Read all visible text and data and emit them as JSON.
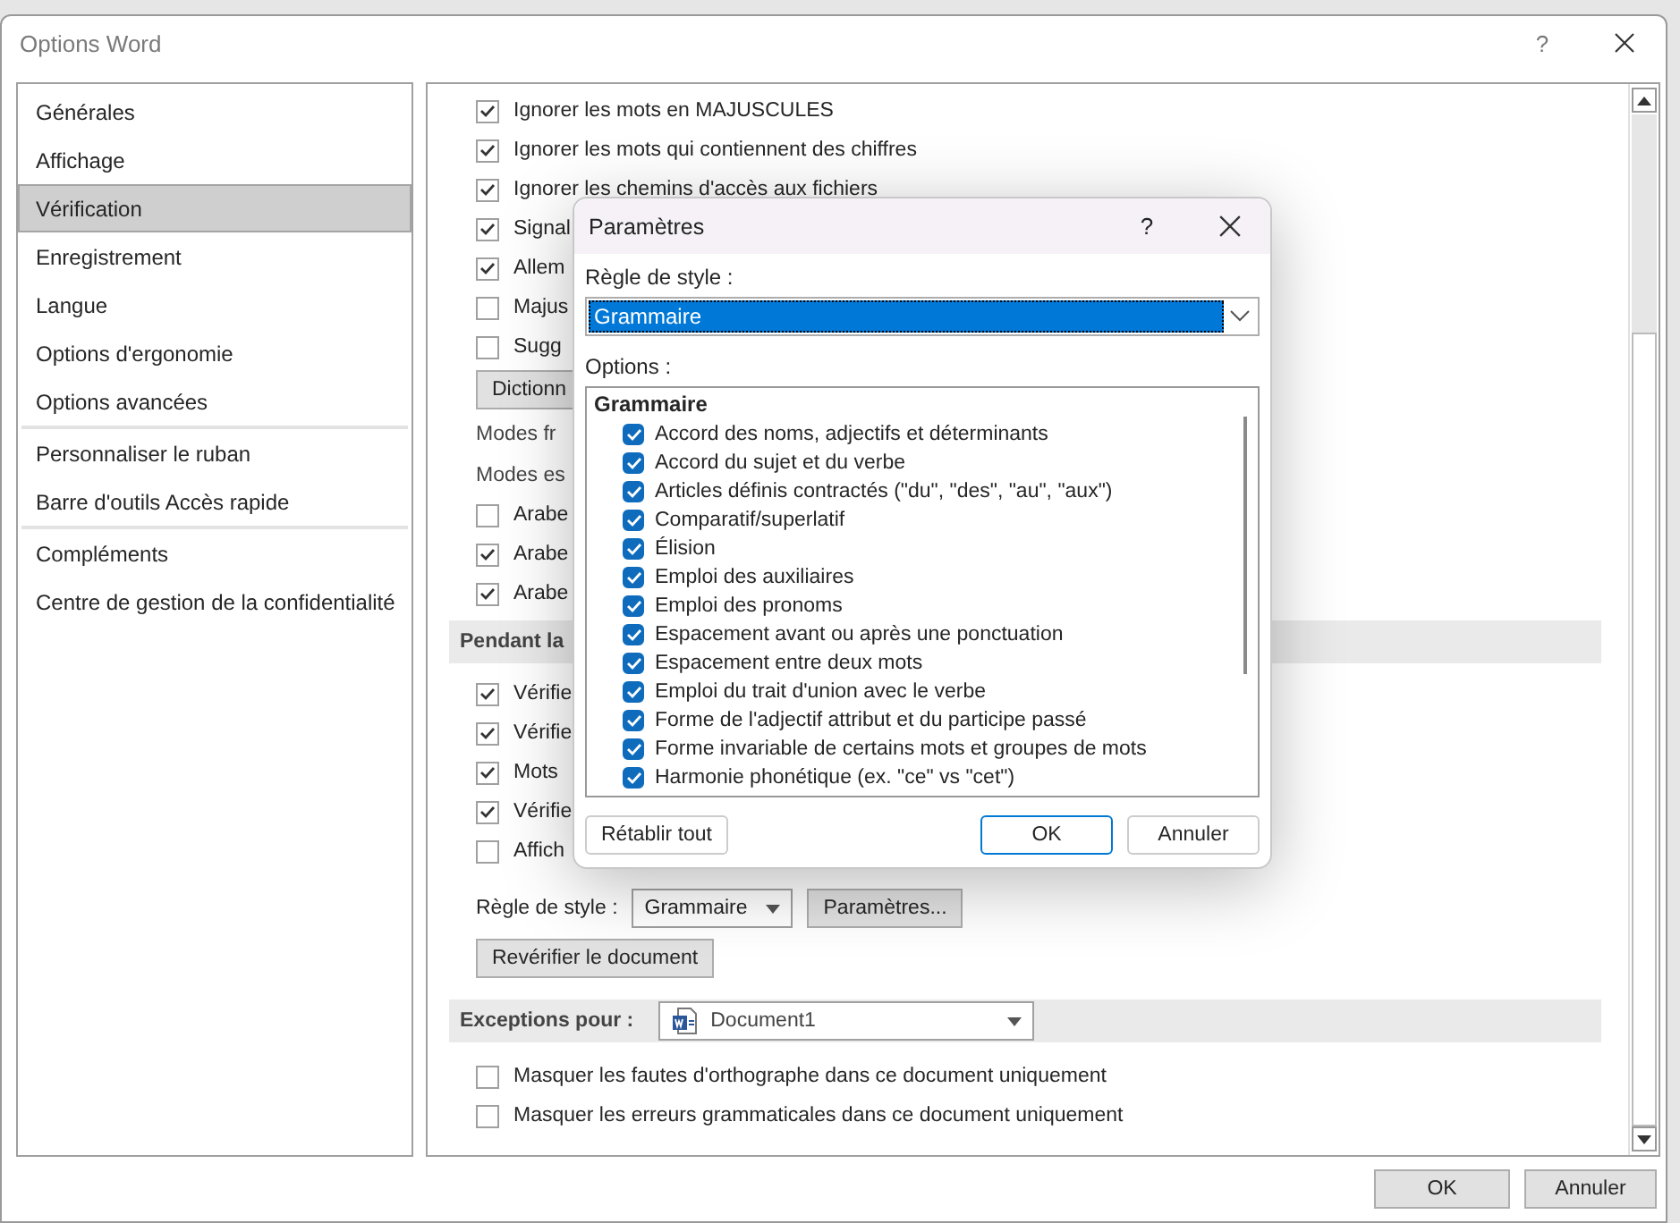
{
  "window": {
    "title": "Options Word",
    "help": "?"
  },
  "sidebar": {
    "groups": [
      {
        "items": [
          {
            "label": "Générales",
            "selected": false
          },
          {
            "label": "Affichage",
            "selected": false
          },
          {
            "label": "Vérification",
            "selected": true
          },
          {
            "label": "Enregistrement",
            "selected": false
          },
          {
            "label": "Langue",
            "selected": false
          },
          {
            "label": "Options d'ergonomie",
            "selected": false
          },
          {
            "label": "Options avancées",
            "selected": false
          }
        ]
      },
      {
        "items": [
          {
            "label": "Personnaliser le ruban",
            "selected": false
          },
          {
            "label": "Barre d'outils Accès rapide",
            "selected": false
          }
        ]
      },
      {
        "items": [
          {
            "label": "Compléments",
            "selected": false
          },
          {
            "label": "Centre de gestion de la confidentialité",
            "selected": false
          }
        ]
      }
    ]
  },
  "content": {
    "rows": [
      {
        "kind": "checkbox",
        "label": "Ignorer les mots en MAJUSCULES",
        "checked": true
      },
      {
        "kind": "checkbox",
        "label": "Ignorer les mots qui contiennent des chiffres",
        "checked": true
      },
      {
        "kind": "checkbox",
        "label": "Ignorer les chemins d'accès aux fichiers",
        "checked": true
      },
      {
        "kind": "checkbox",
        "label": "Signal",
        "checked": true
      },
      {
        "kind": "checkbox",
        "label": "Allem",
        "checked": true
      },
      {
        "kind": "checkbox",
        "label": "Majus",
        "checked": false
      },
      {
        "kind": "checkbox",
        "label": "Sugg",
        "checked": false
      },
      {
        "kind": "button",
        "label": "Dictionn"
      },
      {
        "kind": "text",
        "label": "Modes fr"
      },
      {
        "kind": "text",
        "label": "Modes es"
      },
      {
        "kind": "checkbox",
        "label": "Arabe",
        "checked": false
      },
      {
        "kind": "checkbox",
        "label": "Arabe",
        "checked": true
      },
      {
        "kind": "checkbox",
        "label": "Arabe",
        "checked": true
      },
      {
        "kind": "section",
        "label": "Pendant la"
      },
      {
        "kind": "checkbox",
        "label": "Vérifie",
        "checked": true
      },
      {
        "kind": "checkbox",
        "label": "Vérifie",
        "checked": true
      },
      {
        "kind": "checkbox",
        "label": "Mots",
        "checked": true
      },
      {
        "kind": "checkbox",
        "label": "Vérifie",
        "checked": true
      },
      {
        "kind": "checkbox",
        "label": "Affich",
        "checked": false
      },
      {
        "kind": "style_rule",
        "label": "Règle de style :",
        "value": "Grammaire",
        "button": "Paramètres..."
      },
      {
        "kind": "button",
        "label": "Revérifier le document"
      },
      {
        "kind": "exceptions",
        "label": "Exceptions pour :",
        "value": "Document1"
      },
      {
        "kind": "checkbox",
        "label": "Masquer les fautes d'orthographe dans ce document uniquement",
        "checked": false
      },
      {
        "kind": "checkbox",
        "label": "Masquer les erreurs grammaticales dans ce document uniquement",
        "checked": false
      }
    ]
  },
  "footer": {
    "buttons": [
      "OK",
      "Annuler"
    ]
  },
  "modal": {
    "title": "Paramètres",
    "help": "?",
    "style_label": "Règle de style :",
    "style_value": "Grammaire",
    "options_label": "Options :",
    "group": "Grammaire",
    "options": [
      {
        "label": "Accord des noms, adjectifs et déterminants",
        "checked": true
      },
      {
        "label": "Accord du sujet et du verbe",
        "checked": true
      },
      {
        "label": "Articles définis contractés (\"du\", \"des\", \"au\", \"aux\")",
        "checked": true
      },
      {
        "label": "Comparatif/superlatif",
        "checked": true
      },
      {
        "label": "Élision",
        "checked": true
      },
      {
        "label": "Emploi des auxiliaires",
        "checked": true
      },
      {
        "label": "Emploi des pronoms",
        "checked": true
      },
      {
        "label": "Espacement avant ou après une ponctuation",
        "checked": true
      },
      {
        "label": "Espacement entre deux mots",
        "checked": true
      },
      {
        "label": "Emploi du trait d'union avec le verbe",
        "checked": true
      },
      {
        "label": "Forme de l'adjectif attribut et du participe passé",
        "checked": true
      },
      {
        "label": "Forme invariable de certains mots et groupes de mots",
        "checked": true
      },
      {
        "label": "Harmonie phonétique (ex. \"ce\" vs \"cet\")",
        "checked": true
      }
    ],
    "reset": "Rétablir tout",
    "ok": "OK",
    "cancel": "Annuler"
  }
}
